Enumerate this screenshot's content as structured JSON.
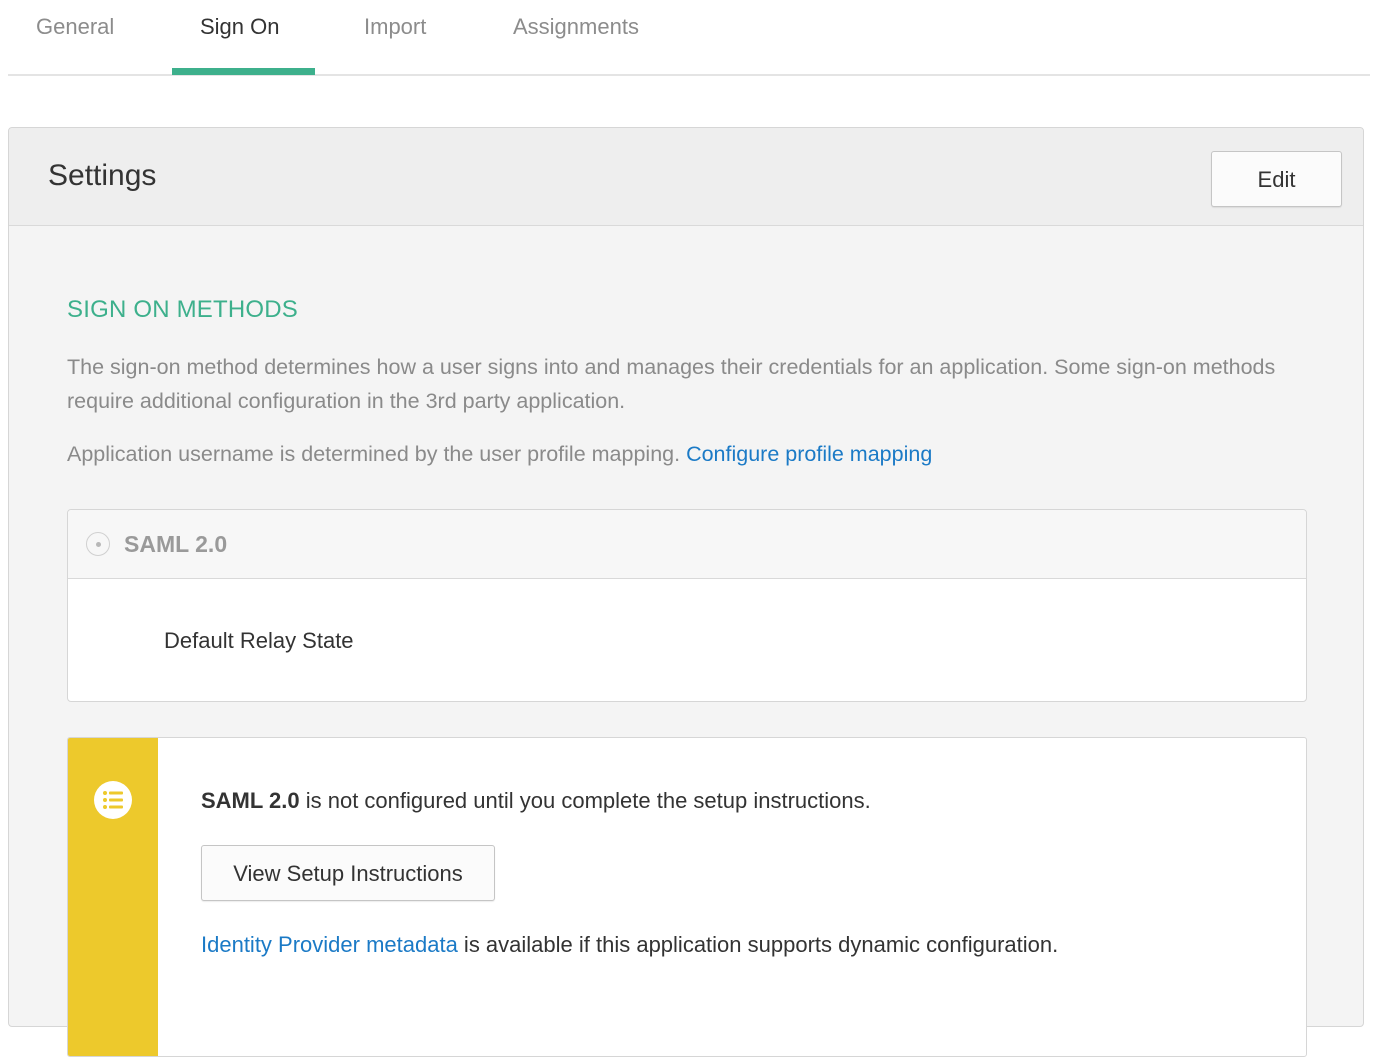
{
  "tabs": [
    {
      "label": "General",
      "active": false
    },
    {
      "label": "Sign On",
      "active": true
    },
    {
      "label": "Import",
      "active": false
    },
    {
      "label": "Assignments",
      "active": false
    }
  ],
  "settings": {
    "title": "Settings",
    "edit_label": "Edit"
  },
  "sign_on_methods": {
    "heading": "SIGN ON METHODS",
    "description": "The sign-on method determines how a user signs into and manages their credentials for an application. Some sign-on methods require additional configuration in the 3rd party application.",
    "username_text": "Application username is determined by the user profile mapping.",
    "configure_link": "Configure profile mapping"
  },
  "saml": {
    "label": "SAML 2.0",
    "relay_state_label": "Default Relay State"
  },
  "notice": {
    "icon": "list-icon",
    "bold_text": "SAML 2.0",
    "message": " is not configured until you complete the setup instructions.",
    "setup_button": "View Setup Instructions",
    "metadata_link": "Identity Provider metadata",
    "metadata_text": " is available if this application supports dynamic configuration."
  },
  "colors": {
    "accent": "#3db08c",
    "link": "#1b7ac6",
    "notice_stripe": "#edc92c"
  }
}
